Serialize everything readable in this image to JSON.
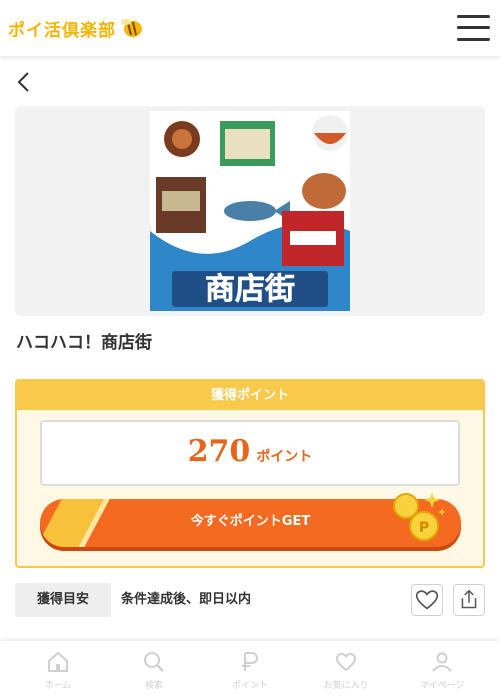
{
  "header": {
    "logo_text": "ポイ活倶楽部",
    "logo_icon": "bee-icon",
    "menu_icon": "hamburger-menu-icon"
  },
  "back_icon": "chevron-left-icon",
  "campaign": {
    "banner_caption": "商店街",
    "title": "ハコハコ！商店街"
  },
  "points": {
    "heading": "獲得ポイント",
    "value": "270",
    "unit": "ポイント",
    "cta_label": "今すぐポイントGET"
  },
  "guide": {
    "label": "獲得目安",
    "text": "条件達成後、即日以内"
  },
  "actions": {
    "favorite_icon": "heart-icon",
    "share_icon": "share-icon"
  },
  "bottom_nav": [
    {
      "label": "ホーム",
      "icon": "home-icon"
    },
    {
      "label": "検索",
      "icon": "search-icon"
    },
    {
      "label": "ポイント",
      "icon": "point-icon"
    },
    {
      "label": "お気に入り",
      "icon": "heart-icon"
    },
    {
      "label": "マイページ",
      "icon": "user-icon"
    }
  ],
  "colors": {
    "accent": "#f46a20",
    "gold": "#f9c94c",
    "brand": "#f4b400"
  }
}
